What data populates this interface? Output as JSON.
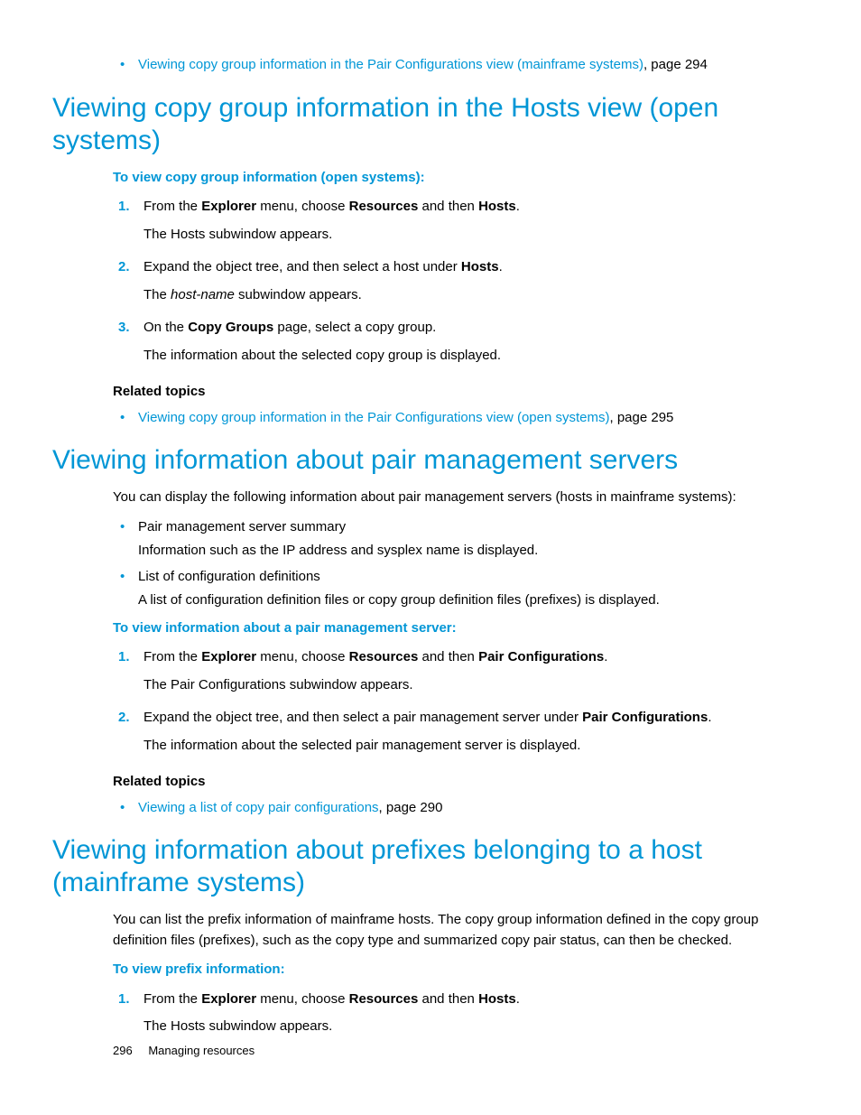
{
  "topBullet": {
    "link": "Viewing copy group information in the Pair Configurations view (mainframe systems)",
    "suffix": ", page 294"
  },
  "section1": {
    "heading": "Viewing copy group information in the Hosts view (open systems)",
    "subhead": "To view copy group information (open systems):",
    "steps": [
      {
        "pre": "From the ",
        "b1": "Explorer",
        "mid1": " menu, choose ",
        "b2": "Resources",
        "mid2": " and then ",
        "b3": "Hosts",
        "post": ".",
        "sub": "The Hosts subwindow appears."
      },
      {
        "pre": "Expand the object tree, and then select a host under ",
        "b1": "Hosts",
        "post": ".",
        "subPre": "The ",
        "subItalic": "host-name",
        "subPost": " subwindow appears."
      },
      {
        "pre": "On the ",
        "b1": "Copy Groups",
        "post": " page, select a copy group.",
        "sub": "The information about the selected copy group is displayed."
      }
    ],
    "relatedHead": "Related topics",
    "related": {
      "link": "Viewing copy group information in the Pair Configurations view (open systems)",
      "suffix": ", page 295"
    }
  },
  "section2": {
    "heading": "Viewing information about pair management servers",
    "intro": "You can display the following information about pair management servers (hosts in mainframe systems):",
    "bullets": [
      {
        "title": "Pair management server summary",
        "desc": "Information such as the IP address and sysplex name is displayed."
      },
      {
        "title": "List of configuration definitions",
        "desc": "A list of configuration definition files or copy group definition files (prefixes) is displayed."
      }
    ],
    "subhead": "To view information about a pair management server:",
    "steps": [
      {
        "pre": "From the ",
        "b1": "Explorer",
        "mid1": " menu, choose ",
        "b2": "Resources",
        "mid2": " and then ",
        "b3": "Pair Configurations",
        "post": ".",
        "sub": "The Pair Configurations subwindow appears."
      },
      {
        "pre": "Expand the object tree, and then select a pair management server under ",
        "b1": "Pair Configurations",
        "post": ".",
        "sub": "The information about the selected pair management server is displayed."
      }
    ],
    "relatedHead": "Related topics",
    "related": {
      "link": "Viewing a list of copy pair configurations",
      "suffix": ", page 290"
    }
  },
  "section3": {
    "heading": "Viewing information about prefixes belonging to a host (mainframe systems)",
    "intro": "You can list the prefix information of mainframe hosts. The copy group information defined in the copy group definition files (prefixes), such as the copy type and summarized copy pair status, can then be checked.",
    "subhead": "To view prefix information:",
    "steps": [
      {
        "pre": "From the ",
        "b1": "Explorer",
        "mid1": " menu, choose ",
        "b2": "Resources",
        "mid2": " and then ",
        "b3": "Hosts",
        "post": ".",
        "sub": "The Hosts subwindow appears."
      }
    ]
  },
  "footer": {
    "page": "296",
    "section": "Managing resources"
  }
}
